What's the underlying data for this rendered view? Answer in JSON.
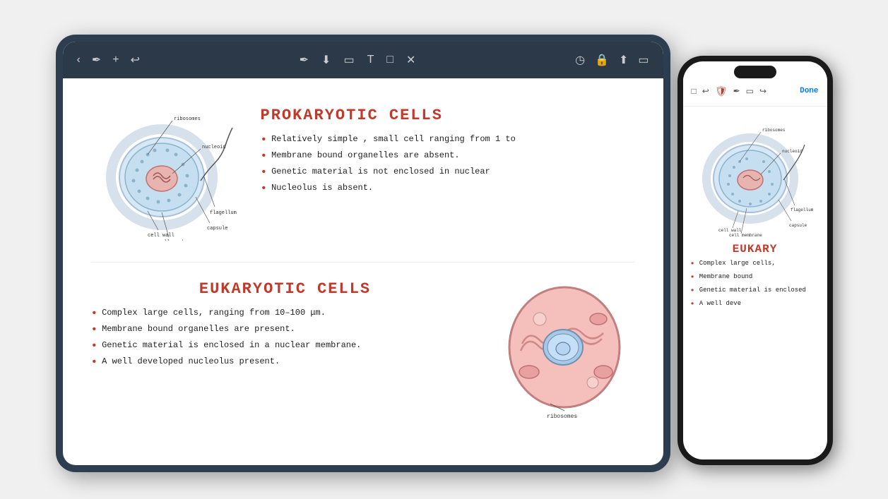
{
  "scene": {
    "background": "#f0f0f0"
  },
  "tablet": {
    "toolbar": {
      "icons": [
        "‹",
        "✏",
        "+",
        "↩",
        "✏",
        "↓",
        "▭",
        "T",
        "□",
        "✕"
      ],
      "right_icons": [
        "⏱",
        "🔒",
        "⬆",
        "▭"
      ]
    },
    "prokaryotic": {
      "title": "PROKARYOTIC  CELLS",
      "bullets": [
        "Relatively  simple , small  cell  ranging  from 1 to",
        "Membrane  bound  organelles   are  absent.",
        "Genetic  material  is  not  enclosed  in  nuclear",
        "Nucleolus  is  absent."
      ]
    },
    "eukaryotic": {
      "title": "EUKARYOTIC  CELLS",
      "bullets": [
        "Complex   large  cells, ranging  from  10–100 μm.",
        "Membrane  bound  organelles  are  present.",
        "Genetic  material  is  enclosed  in  a  nuclear  membrane.",
        "A  well  developed  nucleolus  present."
      ]
    },
    "cell_labels": {
      "prokaryotic": [
        "ribosomes",
        "nucleoid",
        "flagellum",
        "capsule",
        "cell wall",
        "cell membrane"
      ],
      "eukaryotic": [
        "ribosomes"
      ]
    }
  },
  "phone": {
    "toolbar": {
      "icons": [
        "□",
        "↩",
        "🛡",
        "✏",
        "▭",
        "↪"
      ],
      "done_label": "Done"
    },
    "eukaryotic_title": "EUKARY",
    "bullets": [
      "Complex   large cells,",
      "Membrane  bound",
      "Genetic  material  is  enclosed",
      "A  well  deve"
    ]
  }
}
